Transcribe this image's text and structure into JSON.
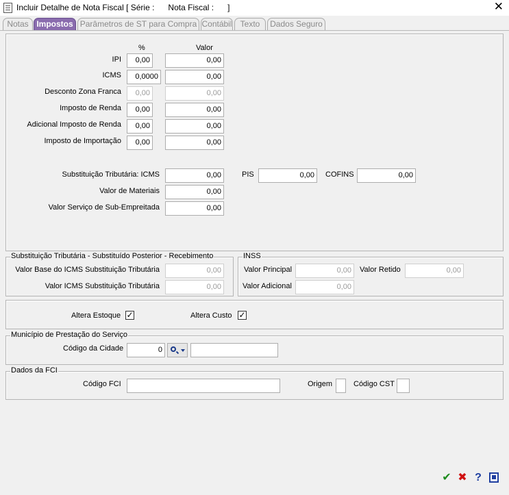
{
  "window": {
    "title": "Incluir Detalhe de Nota Fiscal [ Série :      Nota Fiscal :      ]"
  },
  "tabs": [
    {
      "label": "Notas"
    },
    {
      "label": "Impostos",
      "active": true
    },
    {
      "label": "Parâmetros de ST para Compra"
    },
    {
      "label": "Contábil"
    },
    {
      "label": "Texto"
    },
    {
      "label": "Dados Seguro"
    }
  ],
  "impostos": {
    "col_percent": "%",
    "col_valor": "Valor",
    "rows": [
      {
        "label": "IPI",
        "percent": "0,00",
        "valor": "0,00",
        "enabled": true
      },
      {
        "label": "ICMS",
        "percent": "0,0000",
        "valor": "0,00",
        "enabled": true
      },
      {
        "label": "Desconto Zona Franca",
        "percent": "0,00",
        "valor": "0,00",
        "enabled": false
      },
      {
        "label": "Imposto de Renda",
        "percent": "0,00",
        "valor": "0,00",
        "enabled": true
      },
      {
        "label": "Adicional Imposto de Renda",
        "percent": "0,00",
        "valor": "0,00",
        "enabled": true
      },
      {
        "label": "Imposto de Importação",
        "percent": "0,00",
        "valor": "0,00",
        "enabled": true
      }
    ],
    "st_icms": {
      "label": "Substituição Tributária: ICMS",
      "value": "0,00"
    },
    "pis": {
      "label": "PIS",
      "value": "0,00"
    },
    "cofins": {
      "label": "COFINS",
      "value": "0,00"
    },
    "materiais": {
      "label": "Valor de Materiais",
      "value": "0,00"
    },
    "servico": {
      "label": "Valor Serviço de Sub-Empreitada",
      "value": "0,00"
    }
  },
  "st_posterior": {
    "title": "Substituição Tributária - Substituído Posterior - Recebimento",
    "base": {
      "label": "Valor Base do ICMS Substituição Tributária",
      "value": "0,00"
    },
    "icms": {
      "label": "Valor ICMS Substituição Tributária",
      "value": "0,00"
    }
  },
  "inss": {
    "title": "INSS",
    "principal": {
      "label": "Valor Principal",
      "value": "0,00"
    },
    "retido": {
      "label": "Valor Retido",
      "value": "0,00"
    },
    "adicional": {
      "label": "Valor Adicional",
      "value": "0,00"
    }
  },
  "checkboxes": {
    "estoque": {
      "label": "Altera Estoque",
      "checked": true
    },
    "custo": {
      "label": "Altera Custo",
      "checked": true
    }
  },
  "municipio": {
    "title": "Município de Prestação do Serviço",
    "codigo_label": "Código da Cidade",
    "codigo_value": "0",
    "nome_value": ""
  },
  "fci": {
    "title": "Dados da FCI",
    "codigo_label": "Código FCI",
    "codigo_value": "",
    "origem_label": "Origem",
    "origem_value": "",
    "cst_label": "Código CST",
    "cst_value": ""
  },
  "actions": {
    "confirm_icon": "checkmark-icon",
    "cancel_icon": "red-x-icon",
    "help_icon": "question-icon",
    "extra_icon": "screen-icon",
    "colors": {
      "confirm": "#1e8c1e",
      "cancel": "#d01010",
      "help": "#1f3fa0",
      "tab_active": "#8a6cae"
    }
  }
}
